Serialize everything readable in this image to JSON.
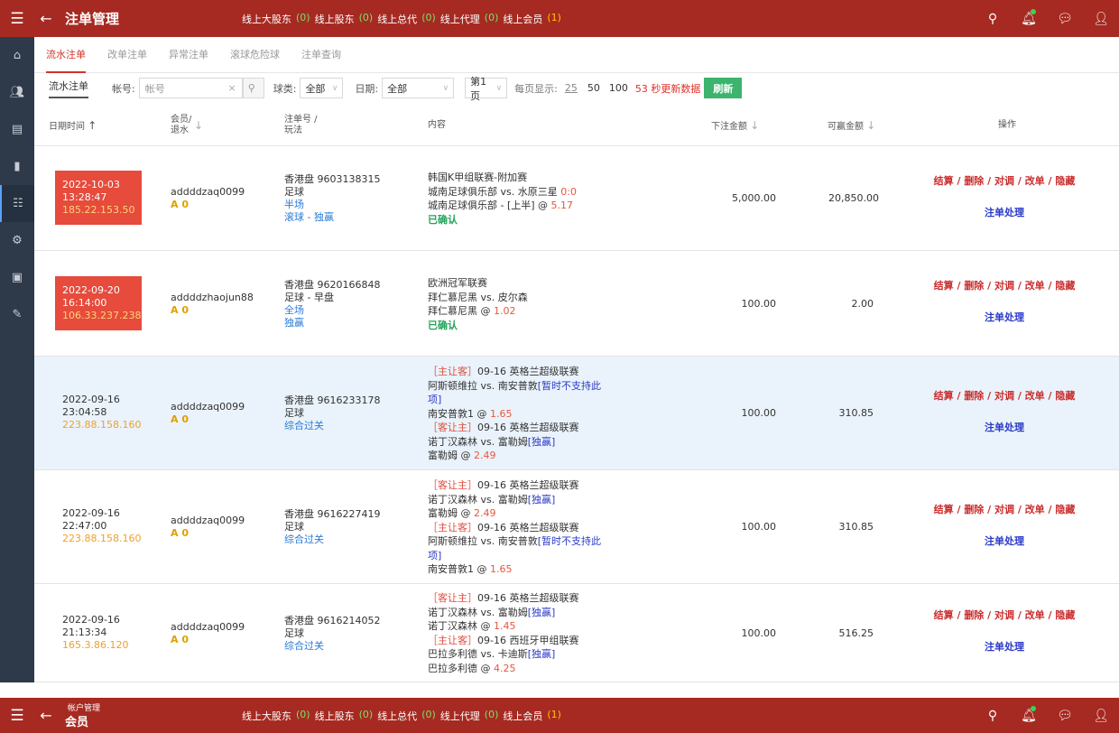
{
  "header": {
    "title": "注单管理",
    "online": [
      {
        "label": "线上大股东",
        "count": "(0)"
      },
      {
        "label": "线上股东",
        "count": "(0)"
      },
      {
        "label": "线上总代",
        "count": "(0)"
      },
      {
        "label": "线上代理",
        "count": "(0)"
      },
      {
        "label": "线上会员",
        "count": "(1)"
      }
    ]
  },
  "header2": {
    "subtitle": "帐户管理",
    "title": "会员"
  },
  "tabs": [
    "流水注单",
    "改单注单",
    "异常注单",
    "滚球危险球",
    "注单查询"
  ],
  "filters": {
    "title": "流水注单",
    "account_label": "帐号:",
    "account_placeholder": "帐号",
    "sport_label": "球类:",
    "sport_value": "全部",
    "date_label": "日期:",
    "date_value": "全部",
    "page_value": "第1页",
    "perpage_label": "每页显示:",
    "perpage": [
      "25",
      "50",
      "100"
    ],
    "countdown": "53 秒更新数据",
    "refresh": "刷新"
  },
  "columns": {
    "datetime": "日期时间",
    "member": "会员/",
    "rebate": "退水",
    "betno": "注单号 /",
    "play": "玩法",
    "content": "内容",
    "amount": "下注金额",
    "winnable": "可赢金额",
    "ops": "操作"
  },
  "ops_labels": [
    "结算",
    "删除",
    "对调",
    "改单",
    "隐藏"
  ],
  "ops_process": "注单处理",
  "rows": [
    {
      "date": "2022-10-03",
      "time": "13:28:47",
      "ip": "185.22.153.50",
      "member": "addddzaq0099",
      "level": "A 0",
      "betno": "香港盘 9603138315",
      "sport": "足球",
      "period": "半场",
      "mode": "滚球 - 独赢",
      "content": [
        {
          "t": "韩国K甲组联赛-附加赛"
        },
        {
          "t": "城南足球俱乐部  vs.  水原三星 ",
          "s": "0:0"
        },
        {
          "t": "城南足球俱乐部  - [上半] @ ",
          "s": "5.17"
        },
        {
          "t": "已确认",
          "g": true
        }
      ],
      "amount": "5,000.00",
      "win": "20,850.00"
    },
    {
      "date": "2022-09-20",
      "time": "16:14:00",
      "ip": "106.33.237.238",
      "member": "addddzhaojun88",
      "level": "A 0",
      "betno": "香港盘 9620166848",
      "sport": "足球 - 早盘",
      "period": "全场",
      "mode": "独赢",
      "content": [
        {
          "t": "欧洲冠军联赛"
        },
        {
          "t": "拜仁慕尼黑  vs.  皮尔森"
        },
        {
          "t": "拜仁慕尼黑 @ ",
          "s": "1.02"
        },
        {
          "t": "已确认",
          "g": true
        }
      ],
      "amount": "100.00",
      "win": "2.00"
    },
    {
      "date": "2022-09-16",
      "time": "23:04:58",
      "ip": "223.88.158.160",
      "member": "addddzaq0099",
      "level": "A 0",
      "betno": "香港盘 9616233178",
      "sport": "足球",
      "period": "综合过关",
      "content": [
        {
          "tag": "［主让客］",
          "t": "09-16 英格兰超级联赛"
        },
        {
          "t": "阿斯顿维拉 vs. 南安普敦",
          "l": "[暂时不支持此项]"
        },
        {
          "t": "南安普敦1 @ ",
          "s": "1.65"
        },
        {
          "tag": "［客让主］",
          "t": "09-16 英格兰超级联赛"
        },
        {
          "t": "诺丁汉森林 vs. 富勒姆",
          "l": "[独赢]"
        },
        {
          "t": "富勒姆 @ ",
          "s": "2.49"
        }
      ],
      "amount": "100.00",
      "win": "310.85"
    },
    {
      "date": "2022-09-16",
      "time": "22:47:00",
      "ip": "223.88.158.160",
      "member": "addddzaq0099",
      "level": "A 0",
      "betno": "香港盘 9616227419",
      "sport": "足球",
      "period": "综合过关",
      "content": [
        {
          "tag": "［客让主］",
          "t": "09-16 英格兰超级联赛"
        },
        {
          "t": "诺丁汉森林 vs. 富勒姆",
          "l": "[独赢]"
        },
        {
          "t": "富勒姆 @ ",
          "s": "2.49"
        },
        {
          "tag": "［主让客］",
          "t": "09-16 英格兰超级联赛"
        },
        {
          "t": "阿斯顿维拉 vs. 南安普敦",
          "l": "[暂时不支持此项]"
        },
        {
          "t": "南安普敦1 @ ",
          "s": "1.65"
        }
      ],
      "amount": "100.00",
      "win": "310.85"
    },
    {
      "date": "2022-09-16",
      "time": "21:13:34",
      "ip": "165.3.86.120",
      "member": "addddzaq0099",
      "level": "A 0",
      "betno": "香港盘 9616214052",
      "sport": "足球",
      "period": "综合过关",
      "content": [
        {
          "tag": "［客让主］",
          "t": "09-16 英格兰超级联赛"
        },
        {
          "t": "诺丁汉森林 vs. 富勒姆",
          "l": "[独赢]"
        },
        {
          "t": "诺丁汉森林 @ ",
          "s": "1.45"
        },
        {
          "tag": "［主让客］",
          "t": "09-16 西班牙甲组联赛"
        },
        {
          "t": "巴拉多利德 vs. 卡迪斯",
          "l": "[独赢]"
        },
        {
          "t": "巴拉多利德 @ ",
          "s": "4.25"
        }
      ],
      "amount": "100.00",
      "win": "516.25"
    }
  ]
}
